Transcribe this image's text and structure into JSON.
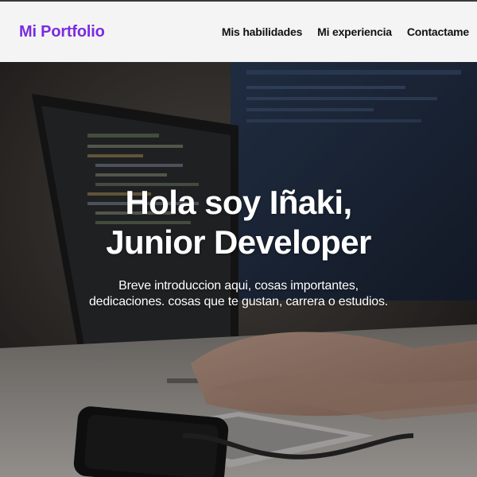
{
  "navbar": {
    "brand": "Mi Portfolio",
    "links": [
      "Mis habilidades",
      "Mi experiencia",
      "Contactame"
    ]
  },
  "hero": {
    "title_line1": "Hola soy Iñaki,",
    "title_line2": "Junior Developer",
    "intro_line1": "Breve introduccion aqui, cosas importantes,",
    "intro_line2": "dedicaciones. cosas que te gustan, carrera o estudios.",
    "background_image": "laptop-coding-photo"
  },
  "colors": {
    "brand": "#7b2be0",
    "navbar_bg": "#f4f4f4",
    "hero_text": "#ffffff"
  }
}
